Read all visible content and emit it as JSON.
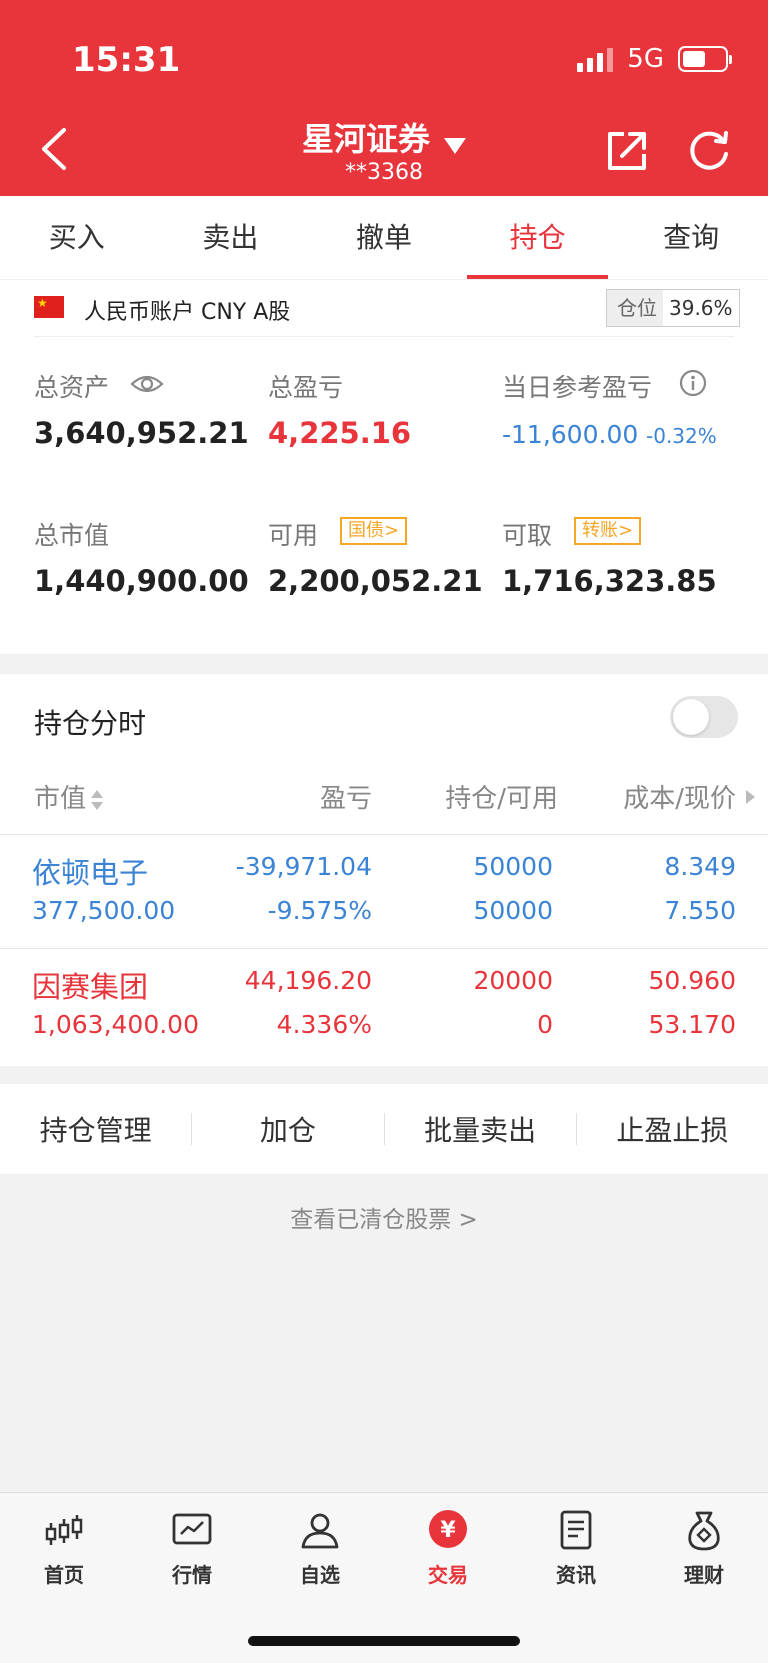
{
  "status_bar": {
    "time": "15:31",
    "network": "5G"
  },
  "header": {
    "title": "星河证券",
    "account_no": "**3368"
  },
  "tabs": [
    {
      "label": "买入"
    },
    {
      "label": "卖出"
    },
    {
      "label": "撤单"
    },
    {
      "label": "持仓",
      "active": true
    },
    {
      "label": "查询"
    }
  ],
  "account": {
    "label": "人民币账户 CNY A股",
    "position_label": "仓位",
    "position_value": "39.6%"
  },
  "metrics": {
    "total_assets": {
      "label": "总资产",
      "value": "3,640,952.21"
    },
    "total_pnl": {
      "label": "总盈亏",
      "value": "4,225.16"
    },
    "daily_pnl": {
      "label": "当日参考盈亏",
      "value": "-11,600.00",
      "percent": "-0.32%"
    },
    "market_value": {
      "label": "总市值",
      "value": "1,440,900.00"
    },
    "available": {
      "label": "可用",
      "tag": "国债>",
      "value": "2,200,052.21"
    },
    "withdrawable": {
      "label": "可取",
      "tag": "转账>",
      "value": "1,716,323.85"
    }
  },
  "holdings": {
    "title": "持仓分时",
    "toggle_on": false,
    "columns": {
      "market_value": "市值",
      "pnl": "盈亏",
      "qty": "持仓/可用",
      "cost": "成本/现价"
    },
    "rows": [
      {
        "name": "依顿电子",
        "market_value": "377,500.00",
        "pnl": "-39,971.04",
        "pnl_pct": "-9.575%",
        "hold": "50000",
        "avail": "50000",
        "cost": "8.349",
        "price": "7.550",
        "color": "#3b83d4"
      },
      {
        "name": "因赛集团",
        "market_value": "1,063,400.00",
        "pnl": "44,196.20",
        "pnl_pct": "4.336%",
        "hold": "20000",
        "avail": "0",
        "cost": "50.960",
        "price": "53.170",
        "color": "#e8343b"
      }
    ]
  },
  "actions": [
    {
      "label": "持仓管理"
    },
    {
      "label": "加仓"
    },
    {
      "label": "批量卖出"
    },
    {
      "label": "止盈止损"
    }
  ],
  "cleared_link": "查看已清仓股票 >",
  "bottom_nav": [
    {
      "label": "首页",
      "icon": "candlestick-icon"
    },
    {
      "label": "行情",
      "icon": "chart-icon"
    },
    {
      "label": "自选",
      "icon": "user-icon"
    },
    {
      "label": "交易",
      "icon": "yuan-icon",
      "active": true
    },
    {
      "label": "资讯",
      "icon": "document-icon"
    },
    {
      "label": "理财",
      "icon": "moneybag-icon"
    }
  ],
  "colors": {
    "brand_red": "#e8343b",
    "loss_blue": "#3b83d4",
    "tag_orange": "#f5a623"
  }
}
